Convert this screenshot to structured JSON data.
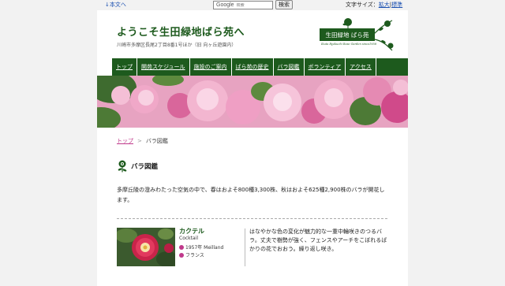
{
  "topbar": {
    "skip_link": "↓本文へ",
    "search_brand": "Google",
    "search_placeholder": "検索",
    "search_button": "検索",
    "fontsize_label": "文字サイズ：",
    "fontsize_large": "拡大",
    "fontsize_sep": "|",
    "fontsize_standard": "標準"
  },
  "header": {
    "title": "ようこそ生田緑地ばら苑へ",
    "address": "川崎市多摩区長尾2丁目8番1号ほか（旧 向ヶ丘遊園内）",
    "logo_text": "生田緑地 ばら苑",
    "logo_sub": "Ikuta Ryokuchi Rose Garden since1958"
  },
  "nav": {
    "items": [
      {
        "label": "トップ"
      },
      {
        "label": "開苑スケジュール"
      },
      {
        "label": "施設のご案内"
      },
      {
        "label": "ばら苑の歴史"
      },
      {
        "label": "バラ図鑑"
      },
      {
        "label": "ボランティア"
      },
      {
        "label": "アクセス"
      }
    ]
  },
  "breadcrumb": {
    "home": "トップ",
    "sep": ">",
    "current": "バラ図鑑"
  },
  "section": {
    "title": "バラ図鑑",
    "intro": "多摩丘陵の澄みわたった空気の中で、春はおよそ800種3,300株、秋はおよそ625種2,900株のバラが開花します。"
  },
  "rose": {
    "name": "カクテル",
    "name_en": "Cocktail",
    "year_breeder": "1957年 Meilland",
    "country": "フランス",
    "description": "はなやかな色の変化が魅力的な一重中輪咲きのつるバラ。丈夫で樹勢が強く、フェンスやアーチをこぼれるばかりの花でおおう。繰り返し咲き。"
  },
  "colors": {
    "brand_green": "#1d5a1d",
    "accent_pink": "#c0398b",
    "link_blue": "#1a4fb0"
  }
}
